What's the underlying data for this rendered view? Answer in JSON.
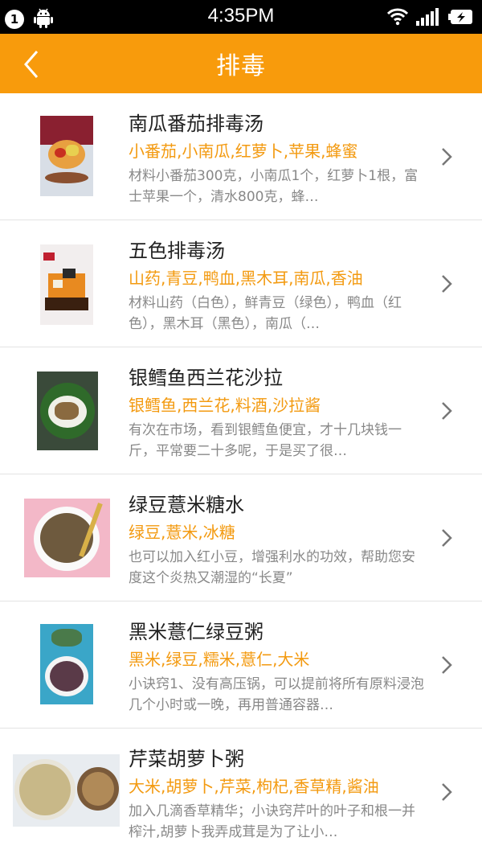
{
  "status_bar": {
    "notification_count": "1",
    "time": "4:35PM"
  },
  "header": {
    "title": "排毒"
  },
  "recipes": [
    {
      "name": "南瓜番茄排毒汤",
      "ingredients": "小番茄,小南瓜,红萝卜,苹果,蜂蜜",
      "description": "材料小番茄300克，小南瓜1个，红萝卜1根，富士苹果一个，清水800克，蜂…"
    },
    {
      "name": "五色排毒汤",
      "ingredients": "山药,青豆,鸭血,黑木耳,南瓜,香油",
      "description": "材料山药（白色），鲜青豆（绿色），鸭血（红色），黑木耳（黑色），南瓜（…"
    },
    {
      "name": "银鳕鱼西兰花沙拉",
      "ingredients": "银鳕鱼,西兰花,料酒,沙拉酱",
      "description": "有次在市场，看到银鳕鱼便宜，才十几块钱一斤，平常要二十多呢，于是买了很…"
    },
    {
      "name": "绿豆薏米糖水",
      "ingredients": "绿豆,薏米,冰糖",
      "description": "也可以加入红小豆，增强利水的功效，帮助您安度这个炎热又潮湿的“长夏”"
    },
    {
      "name": "黑米薏仁绿豆粥",
      "ingredients": "黑米,绿豆,糯米,薏仁,大米",
      "description": "小诀窍1、没有高压锅，可以提前将所有原料浸泡几个小时或一晚，再用普通容器…"
    },
    {
      "name": "芹菜胡萝卜粥",
      "ingredients": "大米,胡萝卜,芹菜,枸杞,香草精,酱油",
      "description": "加入几滴香草精华；小诀窍芹叶的叶子和根一并榨汁,胡萝卜我弄成茸是为了让小…"
    }
  ],
  "colors": {
    "accent": "#f89b0c",
    "ingredients_text": "#f39a10",
    "description_text": "#888888"
  }
}
